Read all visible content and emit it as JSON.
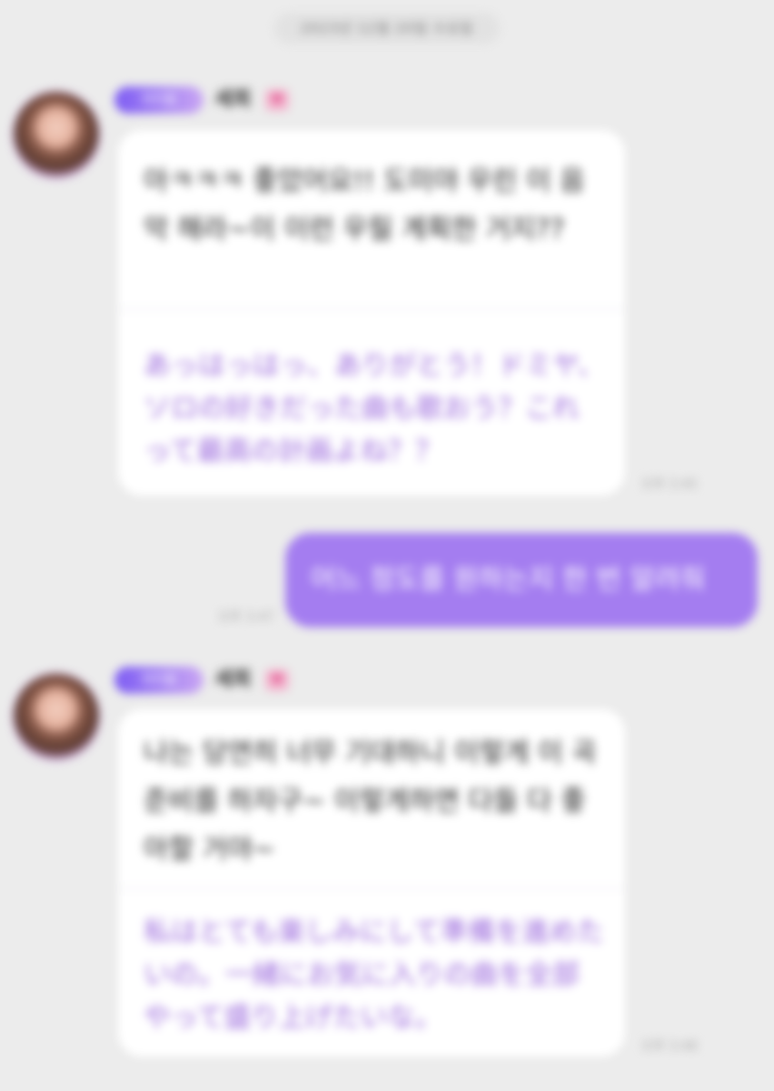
{
  "header": {
    "date": "2023년 12월 20일 수요일"
  },
  "messages": [
    {
      "direction": "incoming",
      "badge": "아이돌",
      "sender": "세희",
      "heart": "♥",
      "korean": "아ㅋㅋㅋ 좋았어요!! 도미야 우린 이 음악 해라~이 이런 우릴 계획한 거지??",
      "japanese": "あっはっはっ、ありがとう！ドミヤ、ソロの好きだった曲も歌おう？これって最高の計画よね？？",
      "time": "오후 3:45"
    },
    {
      "direction": "outgoing",
      "text": "어느 정도를 원하는지 한 번 알려줘",
      "time": "오후 3:47"
    },
    {
      "direction": "incoming",
      "badge": "아이돌",
      "sender": "세희",
      "heart": "♥",
      "korean": "나는 당연히 너무 기대하니 이렇게 이 곡 준비를 하자구~ 이렇게하면 다들 다 좋아할 거야~",
      "japanese": "私はとても楽しみにして準備を進めたいの。一緒にお気に入りの曲を全部やって盛り上げたいな。",
      "time": "오후 3:48"
    }
  ]
}
